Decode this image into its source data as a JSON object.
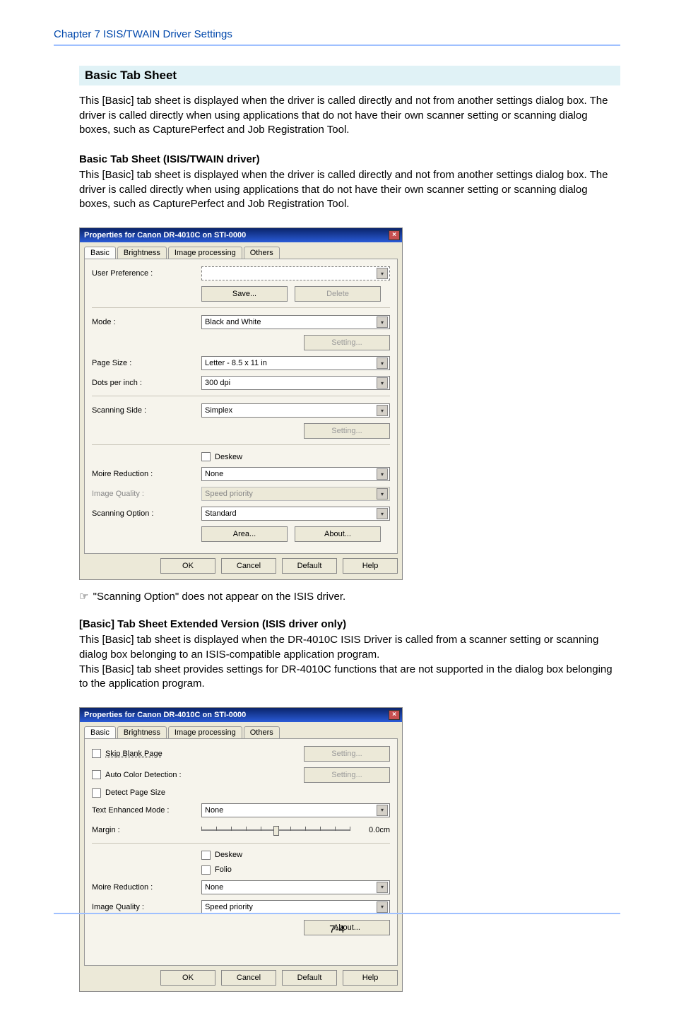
{
  "header": {
    "chapter": "Chapter 7   ISIS/TWAIN Driver Settings"
  },
  "section": {
    "title": "Basic Tab Sheet",
    "intro": "This [Basic] tab sheet is displayed when the driver is called directly and not from another settings dialog box. The driver is called directly when using applications that do not have their own scanner setting or scanning dialog boxes, such as CapturePerfect and Job Registration Tool."
  },
  "sub1": {
    "heading": "Basic Tab Sheet (ISIS/TWAIN driver)",
    "text": "This [Basic] tab sheet is displayed when the driver is called directly and not from another settings dialog box. The driver is called directly when using applications that do not have their own scanner setting or scanning dialog boxes, such as CapturePerfect and Job Registration Tool."
  },
  "dlg": {
    "title": "Properties for Canon DR-4010C on STI-0000",
    "tabs": {
      "basic": "Basic",
      "brightness": "Brightness",
      "image": "Image processing",
      "others": "Others"
    },
    "labels": {
      "userpref": "User Preference :",
      "mode": "Mode :",
      "pagesize": "Page Size :",
      "dpi": "Dots per inch :",
      "side": "Scanning Side :",
      "moire": "Moire Reduction :",
      "iq": "Image Quality :",
      "scanopt": "Scanning Option :"
    },
    "values": {
      "userpref": "",
      "mode": "Black and White",
      "pagesize": "Letter - 8.5 x 11 in",
      "dpi": "300 dpi",
      "side": "Simplex",
      "moire": "None",
      "iq": "Speed priority",
      "scanopt": "Standard"
    },
    "buttons": {
      "save": "Save...",
      "delete": "Delete",
      "setting": "Setting...",
      "area": "Area...",
      "about": "About...",
      "ok": "OK",
      "cancel": "Cancel",
      "default": "Default",
      "help": "Help"
    },
    "checkbox": {
      "deskew": "Deskew"
    }
  },
  "note": "\"Scanning Option\" does not appear on the ISIS driver.",
  "sub2": {
    "heading": "[Basic] Tab Sheet Extended Version (ISIS driver only)",
    "text1": "This [Basic] tab sheet is displayed when the DR-4010C ISIS Driver is called from a scanner setting or scanning dialog box belonging to an ISIS-compatible application program.",
    "text2": "This [Basic] tab sheet provides settings for DR-4010C functions that are not supported in the dialog box belonging to the application program."
  },
  "dlg2": {
    "labels": {
      "skip": "Skip Blank Page",
      "auto": "Auto Color Detection :",
      "detect": "Detect Page Size",
      "tem": "Text Enhanced Mode :",
      "margin": "Margin :",
      "deskew": "Deskew",
      "folio": "Folio",
      "moire": "Moire Reduction :",
      "iq": "Image Quality :"
    },
    "values": {
      "tem": "None",
      "margin": "0.0cm",
      "moire": "None",
      "iq": "Speed priority"
    }
  },
  "footer": {
    "pagenum": "7-4"
  }
}
